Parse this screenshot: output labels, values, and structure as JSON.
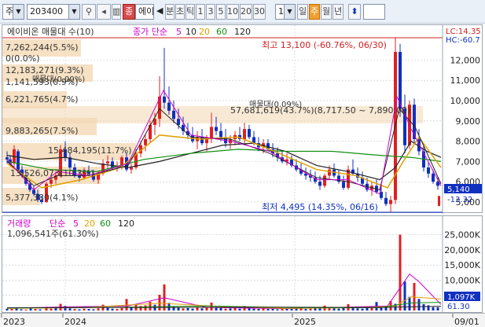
{
  "toolbar": {
    "market_combo": "주",
    "code_input": "203400",
    "search_icon": "search-icon",
    "name_button": "종",
    "name_text": "에이",
    "prev_arrow": "◀",
    "period_buttons": [
      "분",
      "초",
      "틱",
      "1",
      "3",
      "5",
      "10",
      "20",
      "30"
    ],
    "interval_value": "1",
    "day_buttons": [
      "일",
      "주",
      "월",
      "년"
    ],
    "active_day_button": "주",
    "updown_icon": "updown-icon"
  },
  "price_panel": {
    "title": "에이비온 매물대 수(10)",
    "ma_header": "종가 단순",
    "ma_periods": [
      "5",
      "10",
      "20",
      "60",
      "120"
    ],
    "ma_colors": [
      "#cc00cc",
      "#222222",
      "#e0a000",
      "#109010",
      "#222222"
    ],
    "high_label": "최고 13,100 (-60.76%, 06/30)",
    "low_label": "최저 4,495 (14.35%, 06/16)",
    "lc_label": "LC:14.35",
    "hc_label": "HC:-60.7",
    "current_price": "5,140",
    "current_change": "-13.32",
    "y_ticks": [
      "12,000",
      "11,000",
      "10,000",
      "9,000",
      "8,000",
      "7,000",
      "6,000",
      "5,000"
    ],
    "volume_profile": [
      {
        "text": "7,262,244(5.5%)"
      },
      {
        "text": "0(0.0%)"
      },
      {
        "text": "12,183,271(9.3%)"
      },
      {
        "text": "1,141,593(0.9%)"
      },
      {
        "text": "6,221,765(4.7%)"
      },
      {
        "text": "9,883,265(7.5%)"
      },
      {
        "text": "15,484,195(11.7%)"
      },
      {
        "text": "13,526,073(10.3%)"
      },
      {
        "text": "5,377,380(4.1%)"
      }
    ],
    "max_volume_label": "매물대(0.09%)",
    "max_volume_label_left": "매물대(0.00%)",
    "range_label": "57,681,619(43.7%)(8,717.50 ~ 7,890.00)",
    "colors": {
      "up": "#e02020",
      "down": "#1030c0",
      "grid": "#c8c8c8",
      "profile": "#f3d7b0"
    }
  },
  "volume_panel": {
    "title": "거래량",
    "ma_header": "단순",
    "ma_periods": [
      "5",
      "20",
      "60",
      "120"
    ],
    "ma_colors": [
      "#cc00cc",
      "#e0a000",
      "#109010",
      "#222222"
    ],
    "value_label": "1,096,541주(61.30%)",
    "current_volume": "1,097K",
    "current_pct": "61.30",
    "y_ticks": [
      "25,000K",
      "20,000K",
      "15,000K",
      "10,000K",
      "5,000K"
    ]
  },
  "x_axis": {
    "labels": [
      "2023",
      "2024",
      "2025",
      "09/01"
    ]
  }
}
